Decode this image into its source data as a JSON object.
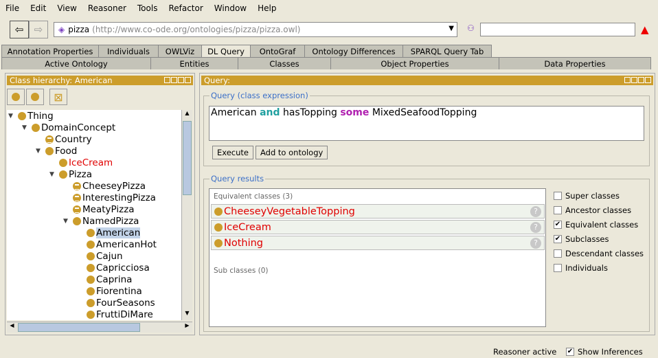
{
  "menu": [
    "File",
    "Edit",
    "View",
    "Reasoner",
    "Tools",
    "Refactor",
    "Window",
    "Help"
  ],
  "ontology": {
    "name": "pizza",
    "iri": "(http://www.co-ode.org/ontologies/pizza/pizza.owl)"
  },
  "search": {
    "value": ""
  },
  "tabs_top": [
    "Annotation Properties",
    "Individuals",
    "OWLViz",
    "DL Query",
    "OntoGraf",
    "Ontology Differences",
    "SPARQL Query Tab"
  ],
  "tabs_bottom": [
    "Active Ontology",
    "Entities",
    "Classes",
    "Object Properties",
    "Data Properties"
  ],
  "class_panel": {
    "title": "Class hierarchy: American",
    "tree": [
      {
        "label": "Thing",
        "depth": 0,
        "exp": true
      },
      {
        "label": "DomainConcept",
        "depth": 1,
        "exp": true
      },
      {
        "label": "Country",
        "depth": 2,
        "eq": true
      },
      {
        "label": "Food",
        "depth": 2,
        "exp": true
      },
      {
        "label": "IceCream",
        "depth": 3,
        "red": true
      },
      {
        "label": "Pizza",
        "depth": 3,
        "exp": true
      },
      {
        "label": "CheeseyPizza",
        "depth": 4,
        "eq": true
      },
      {
        "label": "InterestingPizza",
        "depth": 4,
        "eq": true
      },
      {
        "label": "MeatyPizza",
        "depth": 4,
        "eq": true
      },
      {
        "label": "NamedPizza",
        "depth": 4,
        "exp": true
      },
      {
        "label": "American",
        "depth": 5,
        "sel": true
      },
      {
        "label": "AmericanHot",
        "depth": 5
      },
      {
        "label": "Cajun",
        "depth": 5
      },
      {
        "label": "Capricciosa",
        "depth": 5
      },
      {
        "label": "Caprina",
        "depth": 5
      },
      {
        "label": "Fiorentina",
        "depth": 5
      },
      {
        "label": "FourSeasons",
        "depth": 5
      },
      {
        "label": "FruttiDiMare",
        "depth": 5
      }
    ]
  },
  "query_panel": {
    "title": "Query:",
    "expr_legend": "Query (class expression)",
    "expr": [
      {
        "t": "American ",
        "c": "#000"
      },
      {
        "t": "and",
        "c": "#20a0a0",
        "b": true
      },
      {
        "t": " hasTopping ",
        "c": "#000"
      },
      {
        "t": "some",
        "c": "#b020b0",
        "b": true
      },
      {
        "t": " MixedSeafoodTopping",
        "c": "#000"
      }
    ],
    "execute": "Execute",
    "add": "Add to ontology",
    "results_legend": "Query results",
    "equiv_header": "Equivalent classes (3)",
    "equiv": [
      "CheeseyVegetableTopping",
      "IceCream",
      "Nothing"
    ],
    "sub_header": "Sub classes (0)",
    "options": [
      {
        "label": "Super classes",
        "checked": false
      },
      {
        "label": "Ancestor classes",
        "checked": false
      },
      {
        "label": "Equivalent classes",
        "checked": true
      },
      {
        "label": "Subclasses",
        "checked": true
      },
      {
        "label": "Descendant classes",
        "checked": false
      },
      {
        "label": "Individuals",
        "checked": false
      }
    ]
  },
  "status": {
    "reasoner": "Reasoner active",
    "show_inferences": "Show Inferences",
    "show_inferences_checked": true
  }
}
